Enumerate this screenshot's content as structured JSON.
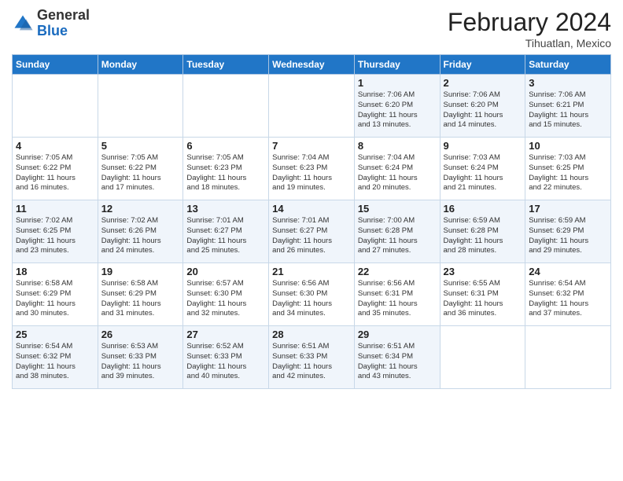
{
  "header": {
    "logo_general": "General",
    "logo_blue": "Blue",
    "title": "February 2024",
    "subtitle": "Tihuatlan, Mexico"
  },
  "weekdays": [
    "Sunday",
    "Monday",
    "Tuesday",
    "Wednesday",
    "Thursday",
    "Friday",
    "Saturday"
  ],
  "weeks": [
    [
      {
        "day": "",
        "info": ""
      },
      {
        "day": "",
        "info": ""
      },
      {
        "day": "",
        "info": ""
      },
      {
        "day": "",
        "info": ""
      },
      {
        "day": "1",
        "info": "Sunrise: 7:06 AM\nSunset: 6:20 PM\nDaylight: 11 hours\nand 13 minutes."
      },
      {
        "day": "2",
        "info": "Sunrise: 7:06 AM\nSunset: 6:20 PM\nDaylight: 11 hours\nand 14 minutes."
      },
      {
        "day": "3",
        "info": "Sunrise: 7:06 AM\nSunset: 6:21 PM\nDaylight: 11 hours\nand 15 minutes."
      }
    ],
    [
      {
        "day": "4",
        "info": "Sunrise: 7:05 AM\nSunset: 6:22 PM\nDaylight: 11 hours\nand 16 minutes."
      },
      {
        "day": "5",
        "info": "Sunrise: 7:05 AM\nSunset: 6:22 PM\nDaylight: 11 hours\nand 17 minutes."
      },
      {
        "day": "6",
        "info": "Sunrise: 7:05 AM\nSunset: 6:23 PM\nDaylight: 11 hours\nand 18 minutes."
      },
      {
        "day": "7",
        "info": "Sunrise: 7:04 AM\nSunset: 6:23 PM\nDaylight: 11 hours\nand 19 minutes."
      },
      {
        "day": "8",
        "info": "Sunrise: 7:04 AM\nSunset: 6:24 PM\nDaylight: 11 hours\nand 20 minutes."
      },
      {
        "day": "9",
        "info": "Sunrise: 7:03 AM\nSunset: 6:24 PM\nDaylight: 11 hours\nand 21 minutes."
      },
      {
        "day": "10",
        "info": "Sunrise: 7:03 AM\nSunset: 6:25 PM\nDaylight: 11 hours\nand 22 minutes."
      }
    ],
    [
      {
        "day": "11",
        "info": "Sunrise: 7:02 AM\nSunset: 6:25 PM\nDaylight: 11 hours\nand 23 minutes."
      },
      {
        "day": "12",
        "info": "Sunrise: 7:02 AM\nSunset: 6:26 PM\nDaylight: 11 hours\nand 24 minutes."
      },
      {
        "day": "13",
        "info": "Sunrise: 7:01 AM\nSunset: 6:27 PM\nDaylight: 11 hours\nand 25 minutes."
      },
      {
        "day": "14",
        "info": "Sunrise: 7:01 AM\nSunset: 6:27 PM\nDaylight: 11 hours\nand 26 minutes."
      },
      {
        "day": "15",
        "info": "Sunrise: 7:00 AM\nSunset: 6:28 PM\nDaylight: 11 hours\nand 27 minutes."
      },
      {
        "day": "16",
        "info": "Sunrise: 6:59 AM\nSunset: 6:28 PM\nDaylight: 11 hours\nand 28 minutes."
      },
      {
        "day": "17",
        "info": "Sunrise: 6:59 AM\nSunset: 6:29 PM\nDaylight: 11 hours\nand 29 minutes."
      }
    ],
    [
      {
        "day": "18",
        "info": "Sunrise: 6:58 AM\nSunset: 6:29 PM\nDaylight: 11 hours\nand 30 minutes."
      },
      {
        "day": "19",
        "info": "Sunrise: 6:58 AM\nSunset: 6:29 PM\nDaylight: 11 hours\nand 31 minutes."
      },
      {
        "day": "20",
        "info": "Sunrise: 6:57 AM\nSunset: 6:30 PM\nDaylight: 11 hours\nand 32 minutes."
      },
      {
        "day": "21",
        "info": "Sunrise: 6:56 AM\nSunset: 6:30 PM\nDaylight: 11 hours\nand 34 minutes."
      },
      {
        "day": "22",
        "info": "Sunrise: 6:56 AM\nSunset: 6:31 PM\nDaylight: 11 hours\nand 35 minutes."
      },
      {
        "day": "23",
        "info": "Sunrise: 6:55 AM\nSunset: 6:31 PM\nDaylight: 11 hours\nand 36 minutes."
      },
      {
        "day": "24",
        "info": "Sunrise: 6:54 AM\nSunset: 6:32 PM\nDaylight: 11 hours\nand 37 minutes."
      }
    ],
    [
      {
        "day": "25",
        "info": "Sunrise: 6:54 AM\nSunset: 6:32 PM\nDaylight: 11 hours\nand 38 minutes."
      },
      {
        "day": "26",
        "info": "Sunrise: 6:53 AM\nSunset: 6:33 PM\nDaylight: 11 hours\nand 39 minutes."
      },
      {
        "day": "27",
        "info": "Sunrise: 6:52 AM\nSunset: 6:33 PM\nDaylight: 11 hours\nand 40 minutes."
      },
      {
        "day": "28",
        "info": "Sunrise: 6:51 AM\nSunset: 6:33 PM\nDaylight: 11 hours\nand 42 minutes."
      },
      {
        "day": "29",
        "info": "Sunrise: 6:51 AM\nSunset: 6:34 PM\nDaylight: 11 hours\nand 43 minutes."
      },
      {
        "day": "",
        "info": ""
      },
      {
        "day": "",
        "info": ""
      }
    ]
  ]
}
